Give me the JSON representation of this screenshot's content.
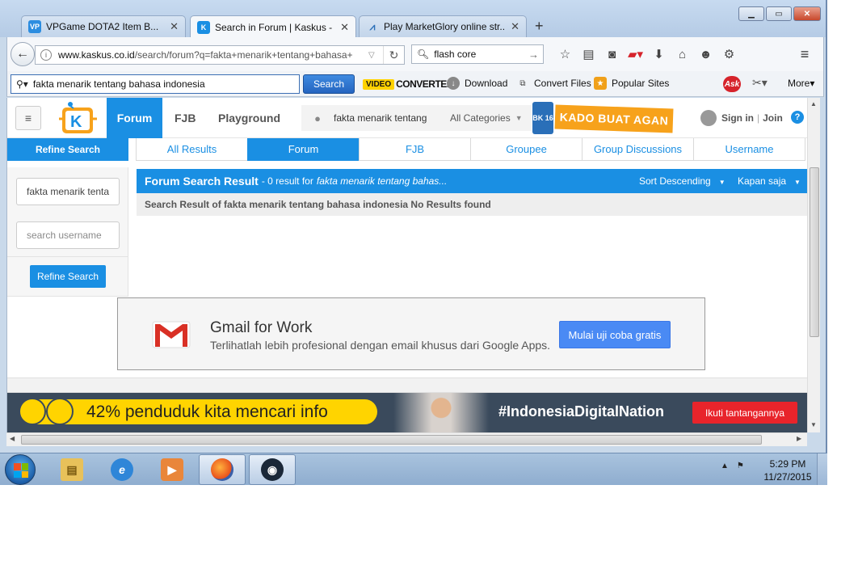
{
  "browser": {
    "tabs": [
      {
        "title": "VPGame DOTA2 Item B...",
        "icon": "vp-favicon",
        "active": false
      },
      {
        "title": "Search in Forum | Kaskus - ...",
        "icon": "kaskus-favicon",
        "active": true
      },
      {
        "title": "Play MarketGlory online str...",
        "icon": "marketglory-favicon",
        "active": false
      }
    ],
    "new_tab": "+",
    "url_host": "www.kaskus.co.id",
    "url_path": "/search/forum?q=fakta+menarik+tentang+bahasa+",
    "search_value": "flash core",
    "toolbar": {
      "ask_query": "fakta menarik tentang bahasa indonesia",
      "search_button": "Search",
      "vdc_logo": "VIDEO",
      "vdc_text": "CONVERTER",
      "download_label": "Download",
      "convert_files_label": "Convert Files",
      "popular_sites_label": "Popular Sites",
      "ask_logo": "Ask",
      "more_label": "More"
    }
  },
  "kaskus": {
    "nav": {
      "forum": "Forum",
      "fjb": "FJB",
      "playground": "Playground"
    },
    "header_search": {
      "query": "fakta menarik tentang",
      "category": "All Categories"
    },
    "kado_label": "KADO BUAT AGAN",
    "kado_badge": "BK 16",
    "sign_in": "Sign in",
    "join": "Join",
    "help": "?",
    "refine_title": "Refine Search",
    "tabs": [
      "All Results",
      "Forum",
      "FJB",
      "Groupee",
      "Group Discussions",
      "Username"
    ],
    "active_tab": "Forum",
    "refine": {
      "query_value": "fakta menarik tenta",
      "username_placeholder": "search username",
      "button": "Refine Search"
    },
    "result_header": {
      "title": "Forum Search Result",
      "count_text": "- 0 result for",
      "query_text": "fakta menarik tentang bahas...",
      "sort_label": "Sort Descending",
      "time_label": "Kapan saja"
    },
    "no_result_text": "Search Result of fakta menarik tentang bahasa indonesia No Results found"
  },
  "ads": {
    "gmail": {
      "title": "Gmail for Work",
      "subtitle": "Terlihatlah lebih profesional dengan email khusus dari Google Apps.",
      "button": "Mulai uji coba gratis"
    },
    "banner": {
      "text": "42% penduduk kita mencari info",
      "hashtag": "#IndonesiaDigitalNation",
      "cta": "Ikuti tantangannya"
    }
  },
  "taskbar": {
    "time": "5:29 PM",
    "date": "11/27/2015",
    "apps": [
      "start-orb",
      "file-explorer",
      "internet-explorer",
      "media-player",
      "firefox",
      "steam"
    ]
  },
  "colors": {
    "kaskus_blue": "#1a8fe3",
    "kado_orange": "#f7a21b",
    "banner_yellow": "#ffd400",
    "banner_red": "#e8242b",
    "gmail_button": "#4a8af4"
  }
}
